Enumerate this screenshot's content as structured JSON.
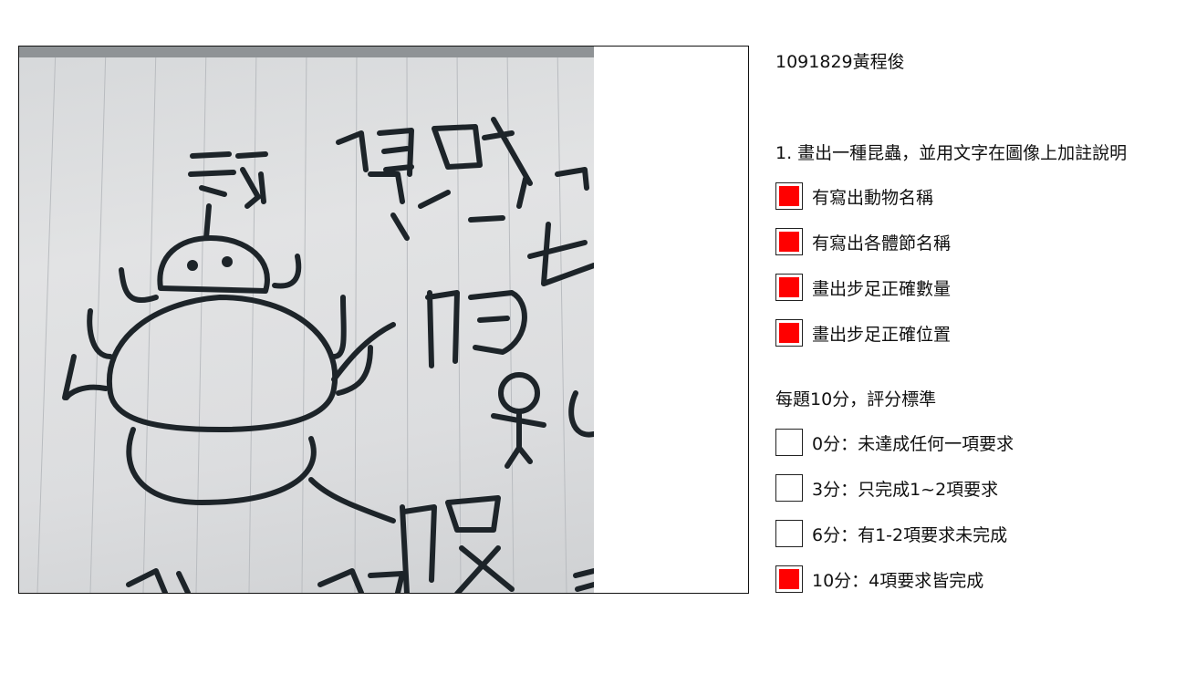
{
  "student": "1091829黃程俊",
  "question": "1. 畫出一種昆蟲，並用文字在圖像上加註說明",
  "criteria": [
    {
      "label": "有寫出動物名稱",
      "checked": true
    },
    {
      "label": "有寫出各體節名稱",
      "checked": true
    },
    {
      "label": "畫出步足正確數量",
      "checked": true
    },
    {
      "label": "畫出步足正確位置",
      "checked": true
    }
  ],
  "score_title": "每題10分，評分標準",
  "scores": [
    {
      "label": "0分：未達成任何一項要求",
      "checked": false
    },
    {
      "label": "3分：只完成1~2項要求",
      "checked": false
    },
    {
      "label": "6分：有1-2項要求未完成",
      "checked": false
    },
    {
      "label": "10分：4項要求皆完成",
      "checked": true
    }
  ],
  "colors": {
    "check_fill": "#ff0000",
    "ink": "#1d2429"
  }
}
